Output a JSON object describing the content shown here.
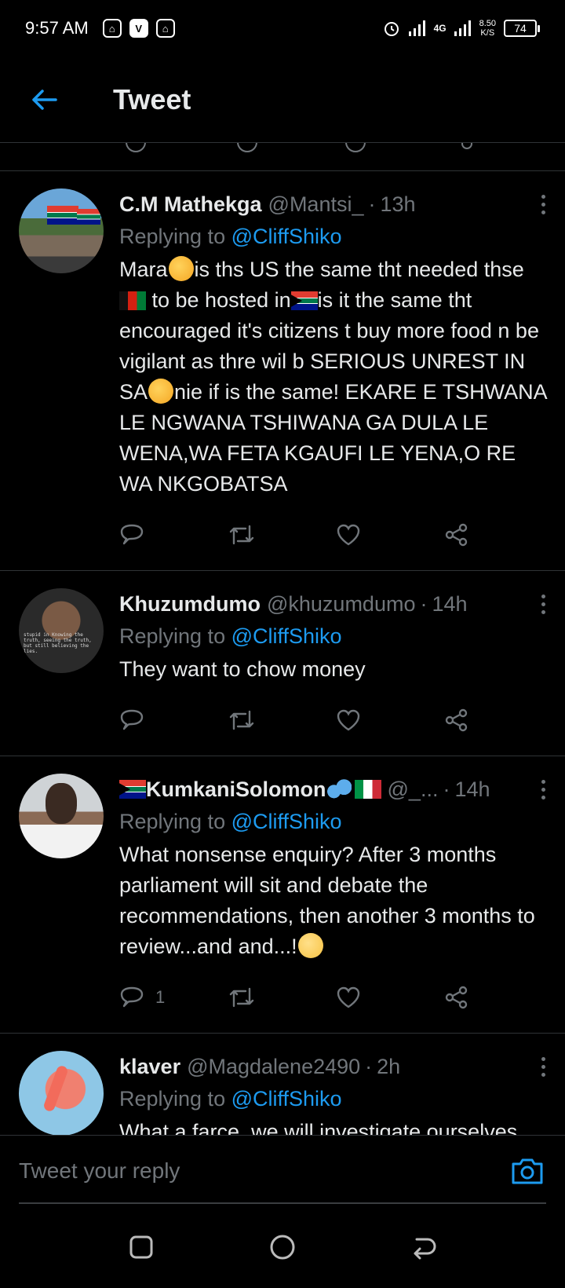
{
  "status_bar": {
    "time": "9:57 AM",
    "network": "4G",
    "speed_value": "8.50",
    "speed_unit": "K/S",
    "battery": "74"
  },
  "header": {
    "title": "Tweet"
  },
  "tweets": [
    {
      "display_name": "C.M Mathekga",
      "handle": "@Mantsi_",
      "separator": "·",
      "time": "13h",
      "reply_prefix": "Replying to",
      "reply_to": "@CliffShiko",
      "text_parts": [
        "Mara",
        "is ths US the same tht needed thse ",
        " to be hosted in",
        "is it the same tht encouraged it's citizens t buy more food n be vigilant as thre wil b SERIOUS UNREST IN SA",
        "nie if is the same! EKARE E TSHWANA LE NGWANA TSHIWANA GA DULA LE WENA,WA FETA KGAUFI LE YENA,O RE WA NKGOBATSA"
      ],
      "reply_count": ""
    },
    {
      "display_name": "Khuzumdumo",
      "handle": "@khuzumdumo",
      "separator": "·",
      "time": "14h",
      "reply_prefix": "Replying to",
      "reply_to": "@CliffShiko",
      "text": "They want to chow money",
      "avatar_text": "stupid in Knowing the truth, seeing the truth, but still believing the lies.",
      "reply_count": ""
    },
    {
      "display_name": "KumkaniSolomon",
      "handle": "@_...",
      "separator": "·",
      "time": "14h",
      "reply_prefix": "Replying to",
      "reply_to": "@CliffShiko",
      "text": "What nonsense enquiry? After 3 months parliament will sit and debate the recommendations,  then another 3 months to review...and and...!",
      "reply_count": "1"
    },
    {
      "display_name": "klaver",
      "handle": "@Magdalene2490",
      "separator": "·",
      "time": "2h",
      "reply_prefix": "Replying to",
      "reply_to": "@CliffShiko",
      "text": "What a farce, we will investigate ourselves and once everyone has"
    }
  ],
  "composer": {
    "placeholder": "Tweet your reply"
  },
  "icons": {
    "back": "arrow-left-icon",
    "reply": "reply-bubble-icon",
    "retweet": "retweet-icon",
    "like": "heart-icon",
    "share": "share-icon",
    "camera": "camera-icon"
  },
  "colors": {
    "accent": "#1d9bf0",
    "background": "#000000",
    "muted": "#71767b"
  }
}
